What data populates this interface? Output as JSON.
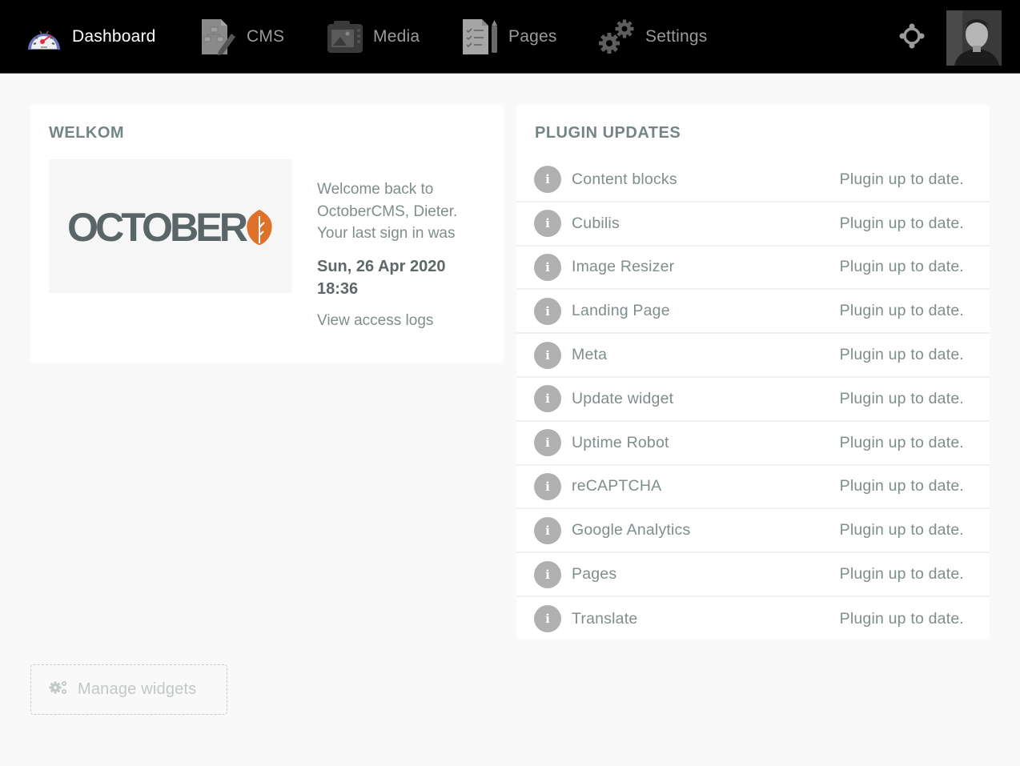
{
  "nav": {
    "items": [
      {
        "label": "Dashboard",
        "icon": "speedometer-icon",
        "active": true
      },
      {
        "label": "CMS",
        "icon": "cms-document-pencil-icon",
        "active": false
      },
      {
        "label": "Media",
        "icon": "media-camera-icon",
        "active": false
      },
      {
        "label": "Pages",
        "icon": "pages-checklist-icon",
        "active": false
      },
      {
        "label": "Settings",
        "icon": "gears-icon",
        "active": false
      }
    ],
    "crosshair_icon": "crosshair-icon",
    "avatar_icon": "user-avatar"
  },
  "welcome": {
    "title": "WELKOM",
    "logo_text": "OCTOBER",
    "message": "Welcome back to OctoberCMS, Dieter. Your last sign in was",
    "last_signin": "Sun, 26 Apr 2020 18:36",
    "access_logs_link": "View access logs",
    "colors": {
      "logo_gray": "#5a6568",
      "logo_orange": "#e0712b"
    }
  },
  "plugins": {
    "title": "PLUGIN UPDATES",
    "items": [
      {
        "name": "Content blocks",
        "status": "Plugin up to date."
      },
      {
        "name": "Cubilis",
        "status": "Plugin up to date."
      },
      {
        "name": "Image Resizer",
        "status": "Plugin up to date."
      },
      {
        "name": "Landing Page",
        "status": "Plugin up to date."
      },
      {
        "name": "Meta",
        "status": "Plugin up to date."
      },
      {
        "name": "Update widget",
        "status": "Plugin up to date."
      },
      {
        "name": "Uptime Robot",
        "status": "Plugin up to date."
      },
      {
        "name": "reCAPTCHA",
        "status": "Plugin up to date."
      },
      {
        "name": "Google Analytics",
        "status": "Plugin up to date."
      },
      {
        "name": "Pages",
        "status": "Plugin up to date."
      },
      {
        "name": "Translate",
        "status": "Plugin up to date."
      }
    ],
    "info_glyph": "i"
  },
  "manage_widgets": {
    "label": "Manage widgets",
    "icon": "gears-icon"
  }
}
